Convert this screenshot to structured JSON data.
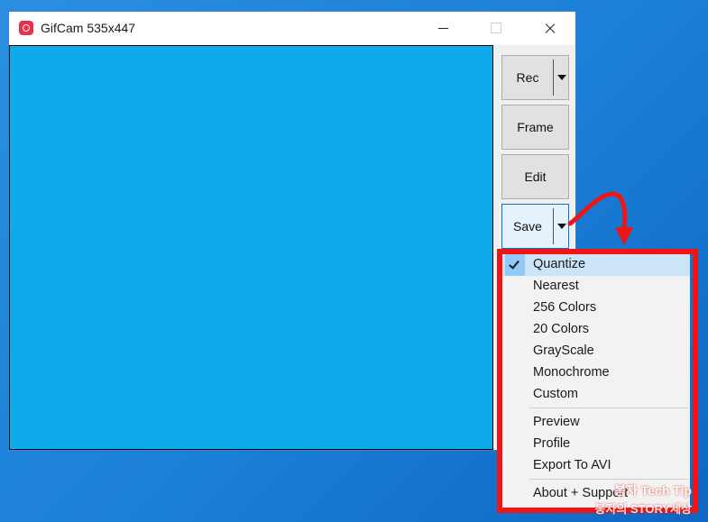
{
  "window": {
    "title": "GifCam 535x447"
  },
  "side_buttons": {
    "rec": "Rec",
    "frame": "Frame",
    "edit": "Edit",
    "save": "Save"
  },
  "menu": {
    "color_options": [
      {
        "label": "Quantize",
        "checked": true
      },
      {
        "label": "Nearest"
      },
      {
        "label": "256 Colors"
      },
      {
        "label": "20 Colors"
      },
      {
        "label": "GrayScale"
      },
      {
        "label": "Monochrome"
      },
      {
        "label": "Custom"
      }
    ],
    "actions": [
      {
        "label": "Preview"
      },
      {
        "label": "Profile"
      },
      {
        "label": "Export To AVI"
      }
    ],
    "footer": {
      "label": "About + Support"
    }
  },
  "watermark": {
    "line1": "봉자 Tech Tip",
    "line2": "봉자의 STORY세상"
  },
  "colors": {
    "capture_area": "#10a9ea",
    "highlight": "#f01414",
    "desktop": "#1a7fd6"
  }
}
